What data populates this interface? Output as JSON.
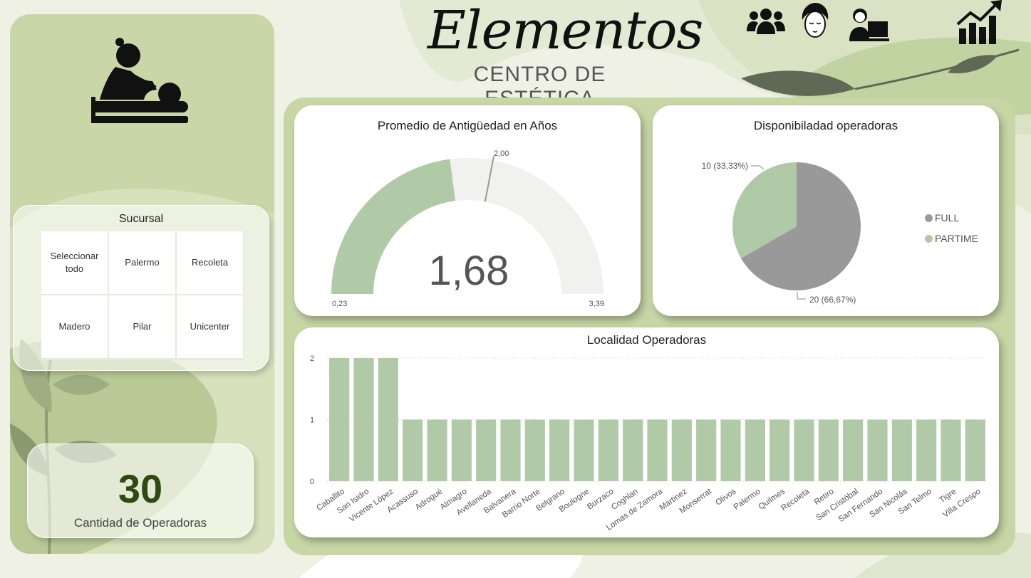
{
  "header": {
    "title": "Elementos",
    "subtitle": "CENTRO DE ESTÉTICA",
    "icons": [
      "people-group-icon",
      "face-spa-icon",
      "operator-computer-icon",
      "growth-chart-icon"
    ]
  },
  "sidebar": {
    "logo_icon": "massage-icon",
    "slicer": {
      "title": "Sucursal",
      "options": [
        "Seleccionar todo",
        "Palermo",
        "Recoleta",
        "Madero",
        "Pilar",
        "Unicenter"
      ]
    },
    "kpi": {
      "value": "30",
      "label": "Cantidad de Operadoras"
    }
  },
  "colors": {
    "green": "#b0c9a7",
    "gray": "#999999",
    "track": "#f1f1f0",
    "panel": "#c7d6a5",
    "kpi_text": "#2e4a12"
  },
  "gauge": {
    "title": "Promedio de Antigüedad en Años",
    "value_label": "1,68",
    "min_label": "0,23",
    "max_label": "3,39",
    "target_label": "2,00"
  },
  "chart_data": [
    {
      "type": "gauge",
      "title": "Promedio de Antigüedad en Años",
      "value": 1.68,
      "min": 0.23,
      "max": 3.39,
      "target": 2.0
    },
    {
      "type": "pie",
      "title": "Disponibilidad operadoras",
      "legend_position": "right",
      "slices": [
        {
          "name": "FULL",
          "value": 20,
          "label": "20 (66,67%)",
          "color": "#999999"
        },
        {
          "name": "PARTIME",
          "value": 10,
          "label": "10 (33,33%)",
          "color": "#b0c9a7"
        }
      ]
    },
    {
      "type": "bar",
      "title": "Localidad Operadoras",
      "categories": [
        "Caballito",
        "San Isidro",
        "Vicente López",
        "Acassuso",
        "Adrogué",
        "Almagro",
        "Avellaneda",
        "Balvanera",
        "Barrio Norte",
        "Belgrano",
        "Boulogne",
        "Burzaco",
        "Coghlan",
        "Lomas de Zamora",
        "Martinez",
        "Monserrat",
        "Olivos",
        "Palermo",
        "Quilmes",
        "Recoleta",
        "Retiro",
        "San Cristóbal",
        "San Fernando",
        "San Nicolás",
        "San Telmo",
        "Tigre",
        "Villa Crespo"
      ],
      "values": [
        2,
        2,
        2,
        1,
        1,
        1,
        1,
        1,
        1,
        1,
        1,
        1,
        1,
        1,
        1,
        1,
        1,
        1,
        1,
        1,
        1,
        1,
        1,
        1,
        1,
        1,
        1
      ],
      "y_ticks": [
        "0",
        "1",
        "2"
      ],
      "ylim": [
        0,
        2
      ],
      "grid": true,
      "color": "#b0c9a7"
    }
  ],
  "pie": {
    "title": "Disponibiladad operadoras",
    "legend": [
      "FULL",
      "PARTIME"
    ],
    "full_label": "20 (66,67%)",
    "partime_label": "10 (33,33%)"
  },
  "bar": {
    "title": "Localidad Operadoras"
  }
}
